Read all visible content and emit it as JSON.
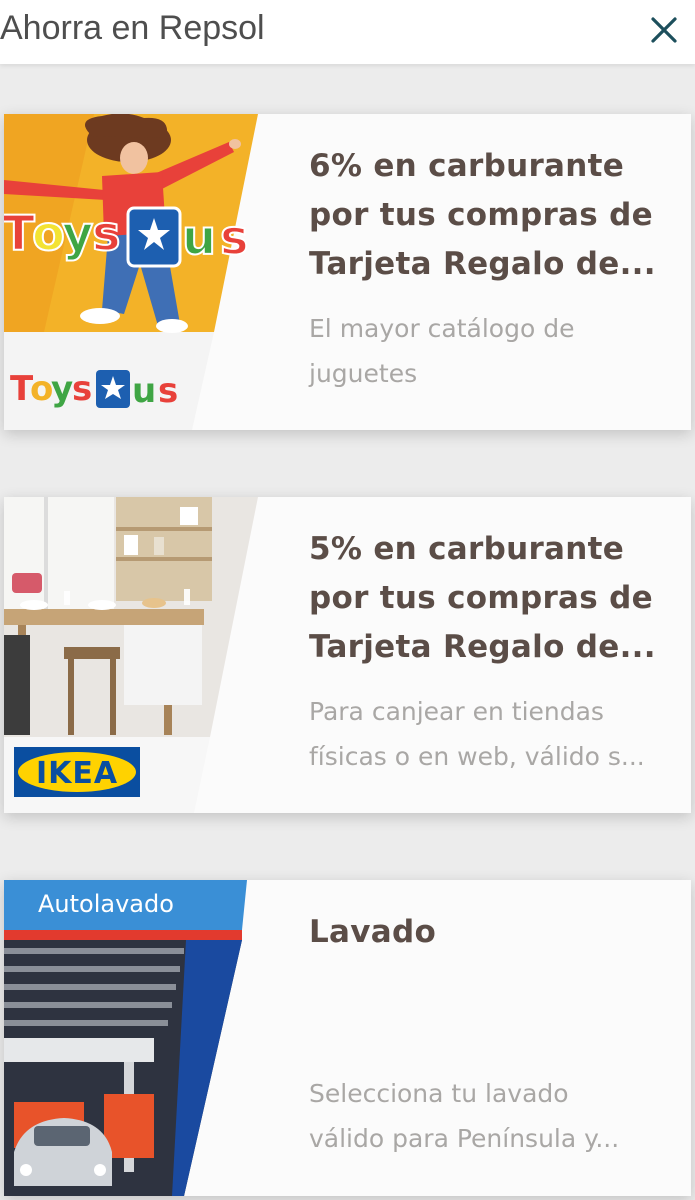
{
  "header": {
    "title": "Ahorra en Repsol",
    "close_icon": "close-icon"
  },
  "colors": {
    "title_text": "#5b4d47",
    "description_text": "#a9a7a5",
    "accent_close": "#1d4f5c",
    "toys_yellow": "#f3b228",
    "ikea_blue": "#0a4ea0",
    "ikea_yellow": "#ffd200"
  },
  "offers": [
    {
      "brand": "Toys R Us",
      "logo_text": "ToysRUs",
      "title": "6% en carburante\npor tus compras de\nTarjeta Regalo de...",
      "description": "El mayor catálogo de\njuguetes"
    },
    {
      "brand": "IKEA",
      "logo_text": "IKEA",
      "title": "5% en carburante\npor tus compras de\nTarjeta Regalo de...",
      "description": "Para canjear en tiendas\nfísicas o en web, válido s..."
    },
    {
      "brand": "Autolavado",
      "sign_text": "Autolavado",
      "title": "Lavado",
      "description": "Selecciona tu lavado\nválido para Península y..."
    }
  ]
}
